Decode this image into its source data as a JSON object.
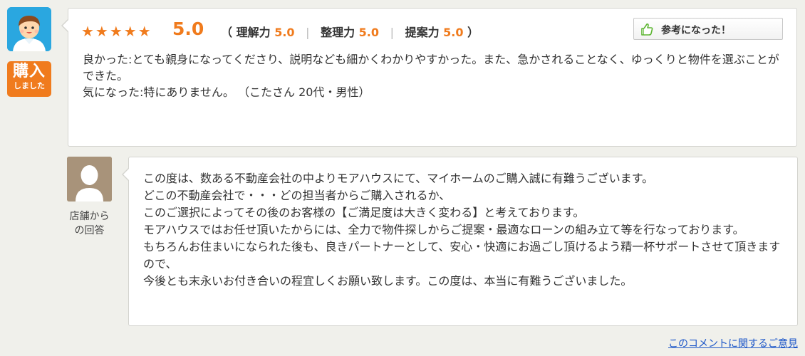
{
  "review": {
    "stars": "★★★★★",
    "score": "5.0",
    "subscores": [
      {
        "label": "理解力",
        "value": "5.0"
      },
      {
        "label": "整理力",
        "value": "5.0"
      },
      {
        "label": "提案力",
        "value": "5.0"
      }
    ],
    "open_paren": "（",
    "close_paren": "）",
    "separator": "|",
    "helpful_label": "参考になった！",
    "good_line": "良かった:とても親身になってくださり、説明なども細かくわかりやすかった。また、急かされることなく、ゆっくりと物件を選ぶことができた。",
    "concern_line": "気になった:特にありません。 （こたさん 20代・男性）"
  },
  "badge": {
    "line1": "購入",
    "line2": "しました"
  },
  "shop_reply": {
    "label_line1": "店舗から",
    "label_line2": "の回答",
    "lines": [
      "この度は、数ある不動産会社の中よりモアハウスにて、マイホームのご購入誠に有難うございます。",
      "どこの不動産会社で・・・どの担当者からご購入されるか、",
      "このご選択によってその後のお客様の【ご満足度は大きく変わる】と考えております。",
      "モアハウスではお任せ頂いたからには、全力で物件探しからご提案・最適なローンの組み立て等を行なっております。",
      "もちろんお住まいになられた後も、良きパートナーとして、安心・快適にお過ごし頂けるよう精一杯サポートさせて頂きますので、",
      "今後とも末永いお付き合いの程宜しくお願い致します。この度は、本当に有難うございました。"
    ]
  },
  "feedback_link": "このコメントに関するご意見",
  "colors": {
    "accent": "#f07b1d",
    "avatar_bg": "#2aa7e0",
    "shop_avatar_bg": "#a8937a",
    "link": "#1a55c8"
  },
  "icons": [
    "user-avatar-icon",
    "shop-avatar-icon",
    "thumbs-up-icon",
    "star-icon"
  ]
}
